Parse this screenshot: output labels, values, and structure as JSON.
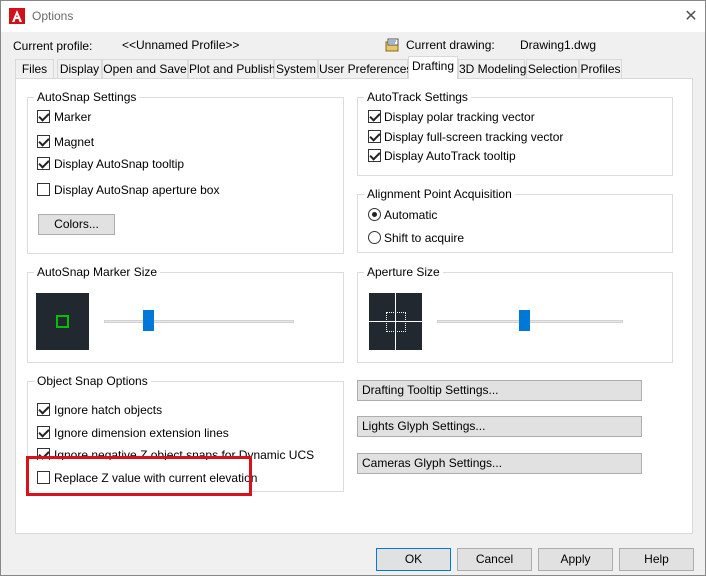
{
  "window": {
    "title": "Options"
  },
  "header": {
    "current_profile_label": "Current profile:",
    "current_profile_value": "<<Unnamed Profile>>",
    "current_drawing_label": "Current drawing:",
    "current_drawing_value": "Drawing1.dwg"
  },
  "tabs": [
    {
      "label": "Files"
    },
    {
      "label": "Display"
    },
    {
      "label": "Open and Save"
    },
    {
      "label": "Plot and Publish"
    },
    {
      "label": "System"
    },
    {
      "label": "User Preferences"
    },
    {
      "label": "Drafting",
      "active": true
    },
    {
      "label": "3D Modeling"
    },
    {
      "label": "Selection"
    },
    {
      "label": "Profiles"
    }
  ],
  "autosnap": {
    "title": "AutoSnap Settings",
    "options": [
      {
        "label": "Marker",
        "checked": true
      },
      {
        "label": "Magnet",
        "checked": true
      },
      {
        "label": "Display AutoSnap tooltip",
        "checked": true
      },
      {
        "label": "Display AutoSnap aperture box",
        "checked": false
      }
    ],
    "colors_button": "Colors..."
  },
  "autotrack": {
    "title": "AutoTrack Settings",
    "options": [
      {
        "label": "Display polar tracking vector",
        "checked": true
      },
      {
        "label": "Display full-screen tracking vector",
        "checked": true
      },
      {
        "label": "Display AutoTrack tooltip",
        "checked": true
      }
    ]
  },
  "alignment": {
    "title": "Alignment Point Acquisition",
    "options": [
      {
        "label": "Automatic",
        "selected": true
      },
      {
        "label": "Shift to acquire",
        "selected": false
      }
    ]
  },
  "marker_size": {
    "title": "AutoSnap Marker Size",
    "level": 0.23
  },
  "aperture_size": {
    "title": "Aperture Size",
    "level": 0.47
  },
  "object_snap": {
    "title": "Object Snap Options",
    "options": [
      {
        "label": "Ignore hatch objects",
        "checked": true
      },
      {
        "label": "Ignore dimension extension lines",
        "checked": true
      },
      {
        "label": "Ignore negative Z object snaps for Dynamic UCS",
        "checked": true
      },
      {
        "label": "Replace Z value with current elevation",
        "checked": false
      }
    ]
  },
  "side_buttons": {
    "tooltip": "Drafting Tooltip Settings...",
    "lights": "Lights Glyph Settings...",
    "cameras": "Cameras Glyph Settings..."
  },
  "footer": {
    "ok": "OK",
    "cancel": "Cancel",
    "apply": "Apply",
    "help": "Help"
  },
  "colors": {
    "marker_green": "#00c000",
    "slider_blue": "#0078d7",
    "highlight_red": "#d9111b",
    "preview_bg": "#212830"
  }
}
